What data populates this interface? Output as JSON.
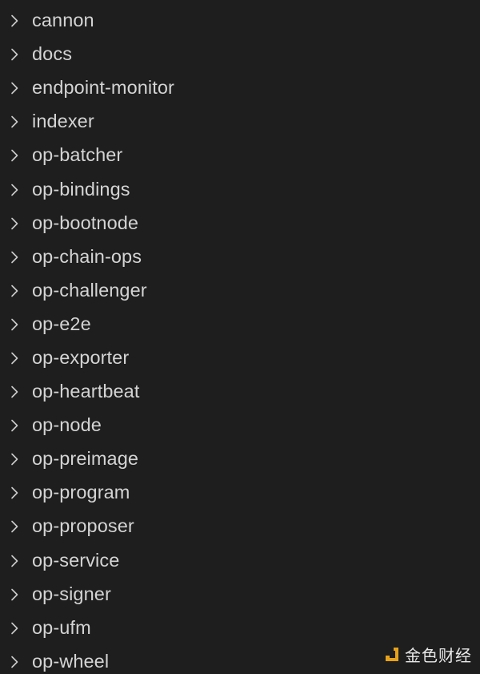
{
  "explorer": {
    "folders": [
      {
        "label": "cannon"
      },
      {
        "label": "docs"
      },
      {
        "label": "endpoint-monitor"
      },
      {
        "label": "indexer"
      },
      {
        "label": "op-batcher"
      },
      {
        "label": "op-bindings"
      },
      {
        "label": "op-bootnode"
      },
      {
        "label": "op-chain-ops"
      },
      {
        "label": "op-challenger"
      },
      {
        "label": "op-e2e"
      },
      {
        "label": "op-exporter"
      },
      {
        "label": "op-heartbeat"
      },
      {
        "label": "op-node"
      },
      {
        "label": "op-preimage"
      },
      {
        "label": "op-program"
      },
      {
        "label": "op-proposer"
      },
      {
        "label": "op-service"
      },
      {
        "label": "op-signer"
      },
      {
        "label": "op-ufm"
      },
      {
        "label": "op-wheel"
      }
    ],
    "folder_icon": "chevron-right-icon",
    "text_color": "#d4d4d4",
    "background": "#1e1e1e"
  },
  "watermark": {
    "text": "金色财经",
    "logo_color": "#e8a21a"
  }
}
